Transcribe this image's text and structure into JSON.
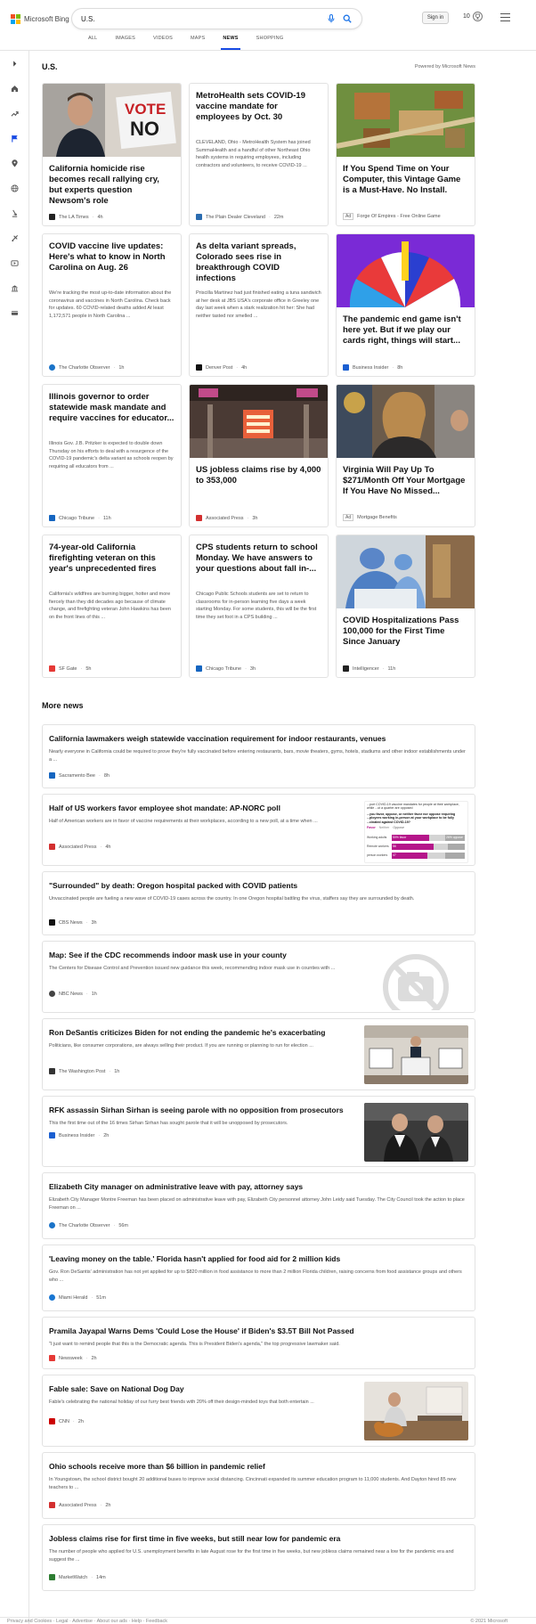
{
  "header": {
    "brand": "Microsoft Bing",
    "search_value": "U.S.",
    "signin_label": "Sign in",
    "rewards_count": "10",
    "tabs": [
      {
        "label": "ALL"
      },
      {
        "label": "IMAGES"
      },
      {
        "label": "VIDEOS"
      },
      {
        "label": "MAPS"
      },
      {
        "label": "NEWS"
      },
      {
        "label": "SHOPPING"
      }
    ],
    "active_tab": "NEWS",
    "brand_colors": [
      "#f25022",
      "#7fba00",
      "#00a4ef",
      "#ffb900"
    ],
    "accent": "#174ae4"
  },
  "rail": {
    "icons": [
      "chevron-right-icon",
      "home-icon",
      "trending-icon",
      "flag-icon",
      "location-pin-icon",
      "globe-icon",
      "science-icon",
      "sports-icon",
      "entertainment-icon",
      "business-icon",
      "money-icon"
    ]
  },
  "section": {
    "title": "U.S.",
    "powered_by": "Powered by Microsoft News"
  },
  "cards": [
    {
      "title": "California homicide rise becomes recall rallying cry, but experts question Newsom's role",
      "snippet": "",
      "source": "The LA Times",
      "time": "4h",
      "source_color": "#222",
      "has_image": true
    },
    {
      "title": "MetroHealth sets COVID-19 vaccine mandate for employees by Oct. 30",
      "snippet": "CLEVELAND, Ohio - MetroHealth System has joined SummaHealth and a handful of other Northeast Ohio health systems in requiring employees, including contractors and volunteers, to receive COVID-19 ...",
      "source": "The Plain Dealer Cleveland",
      "time": "22m",
      "source_color": "#2b6cb0",
      "has_image": false
    },
    {
      "title": "If You Spend Time on Your Computer, this Vintage Game is a Must-Have. No Install.",
      "snippet": "",
      "source": "Forge Of Empires - Free Online Game",
      "time": "",
      "ad_label": "Ad",
      "source_color": "",
      "has_image": true
    },
    {
      "title": "COVID vaccine live updates: Here's what to know in North Carolina on Aug. 26",
      "snippet": "We're tracking the most up-to-date information about the coronavirus and vaccines in North Carolina. Check back for updates. 60 COVID-related deaths added At least 1,172,571 people in North Carolina ...",
      "source": "The Charlotte Observer",
      "time": "1h",
      "source_color": "#1a73c8",
      "has_image": false
    },
    {
      "title": "As delta variant spreads, Colorado sees rise in breakthrough COVID infections",
      "snippet": "Priscilla Martinez had just finished eating a tuna sandwich at her desk at JBS USA's corporate office in Greeley one day last week when a stark realization hit her: She had neither tasted nor smelled ...",
      "source": "Denver Post",
      "time": "4h",
      "source_color": "#111",
      "has_image": false
    },
    {
      "title": "The pandemic end game isn't here yet. But if we play our cards right, things will start...",
      "snippet": "",
      "source": "Business Insider",
      "time": "8h",
      "source_color": "#1b5fd1",
      "has_image": true
    },
    {
      "title": "Illinois governor to order statewide mask mandate and require vaccines for educator...",
      "snippet": "Illinois Gov. J.B. Pritzker is expected to double down Thursday on his efforts to deal with a resurgence of the COVID-19 pandemic's delta variant as schools reopen by requiring all educators from ...",
      "source": "Chicago Tribune",
      "time": "11h",
      "source_color": "#1565c0",
      "has_image": false
    },
    {
      "title": "US jobless claims rise by 4,000 to 353,000",
      "snippet": "",
      "source": "Associated Press",
      "time": "3h",
      "source_color": "#d32f2f",
      "has_image": true
    },
    {
      "title": "Virginia Will Pay Up To $271/Month Off Your Mortgage If You Have No Missed...",
      "snippet": "",
      "source": "Mortgage Benefits",
      "time": "",
      "ad_label": "Ad",
      "source_color": "",
      "has_image": true
    },
    {
      "title": "74-year-old California firefighting veteran on this year's unprecedented fires",
      "snippet": "California's wildfires are burning bigger, hotter and more fiercely than they did decades ago because of climate change, and firefighting veteran John Hawkins has been on the front lines of this ...",
      "source": "SF Gate",
      "time": "5h",
      "source_color": "#e53935",
      "has_image": false
    },
    {
      "title": "CPS students return to school Monday. We have answers to your questions about fall in-...",
      "snippet": "Chicago Public Schools students are set to return to classrooms for in-person learning five days a week starting Monday. For some students, this will be the first time they set foot in a CPS building ...",
      "source": "Chicago Tribune",
      "time": "3h",
      "source_color": "#1565c0",
      "has_image": false
    },
    {
      "title": "COVID Hospitalizations Pass 100,000 for the First Time Since January",
      "snippet": "",
      "source": "Intelligencer",
      "time": "11h",
      "source_color": "#222",
      "has_image": true
    }
  ],
  "more_news": {
    "title": "More news",
    "items": [
      {
        "title": "California lawmakers weigh statewide vaccination requirement for indoor restaurants, venues",
        "snippet": "Nearly everyone in California could be required to prove they're fully vaccinated before entering restaurants, bars, movie theaters, gyms, hotels, stadiums and other indoor establishments under a ...",
        "source": "Sacramento Bee",
        "time": "8h",
        "source_color": "#1565c0"
      },
      {
        "title": "Half of US workers favor employee shot mandate: AP-NORC poll",
        "snippet": "Half of American workers are in favor of vaccine requirements at their workplaces, according to a new poll, at a time when ...",
        "source": "Associated Press",
        "time": "4h",
        "source_color": "#d32f2f",
        "thumb": {
          "heading": "...port COVID-19 vaccine mandates for people at their workplace, while ...ut a quarter are opposed",
          "question": "...you favor, oppose, or neither favor nor oppose requiring ...ployees working in-person at your workplace to be fully ...cinated against COVID-19?",
          "legend": [
            "Favor",
            "Neither",
            "Oppose"
          ],
          "rows": [
            {
              "label": "Working adults",
              "favor_text": "50% favor",
              "oppose_text": "26% oppose"
            },
            {
              "label": "Remote workers",
              "favor_text": "56",
              "oppose_text": ""
            },
            {
              "label": "person workers",
              "favor_text": "47",
              "oppose_text": ""
            }
          ]
        }
      },
      {
        "title": "\"Surrounded\" by death: Oregon hospital packed with COVID patients",
        "snippet": "Unvaccinated people are fueling a new wave of COVID-19 cases across the country. In one Oregon hospital battling the virus, staffers say they are surrounded by death.",
        "source": "CBS News",
        "time": "3h",
        "source_color": "#111"
      },
      {
        "title": "Map: See if the CDC recommends indoor mask use in your county",
        "snippet": "The Centers for Disease Control and Prevention issued new guidance this week, recommending indoor mask use in counties with ...",
        "source": "NBC News",
        "time": "1h",
        "source_color": "#444"
      },
      {
        "title": "Ron DeSantis criticizes Biden for not ending the pandemic he's exacerbating",
        "snippet": "Politicians, like consumer corporations, are always selling their product. If you are running or planning to run for election ...",
        "source": "The Washington Post",
        "time": "1h",
        "source_color": "#333"
      },
      {
        "title": "RFK assassin Sirhan Sirhan is seeing parole with no opposition from prosecutors",
        "snippet": "This the first time out of the 16 times Sirhan Sirhan has sought parole that it will be unopposed by prosecutors.",
        "source": "Business Insider",
        "time": "2h",
        "source_color": "#1b5fd1"
      },
      {
        "title": "Elizabeth City manager on administrative leave with pay, attorney says",
        "snippet": "Elizabeth City Manager Montre Freeman has been placed on administrative leave with pay, Elizabeth City personnel attorney John Leidy said Tuesday. The City Council took the action to place Freeman on ...",
        "source": "The Charlotte Observer",
        "time": "56m",
        "source_color": "#1a73c8"
      },
      {
        "title": "'Leaving money on the table.' Florida hasn't applied for food aid for 2 million kids",
        "snippet": "Gov. Ron DeSantis' administration has not yet applied for up to $820 million in food assistance to more than 2 million Florida children, raising concerns from food assistance groups and others who ...",
        "source": "Miami Herald",
        "time": "51m",
        "source_color": "#1976d2"
      },
      {
        "title": "Pramila Jayapal Warns Dems 'Could Lose the House' if Biden's $3.5T Bill Not Passed",
        "snippet": "\"I just want to remind people that this is the Democratic agenda. This is President Biden's agenda,\" the top progressive lawmaker said.",
        "source": "Newsweek",
        "time": "2h",
        "source_color": "#e53935"
      },
      {
        "title": "Fable sale: Save on National Dog Day",
        "snippet": "Fable's celebrating the national holiday of our furry best friends with 20% off their design-minded toys that both entertain ...",
        "source": "CNN",
        "time": "2h",
        "source_color": "#cc0000"
      },
      {
        "title": "Ohio schools receive more than $6 billion in pandemic relief",
        "snippet": "In Youngstown, the school district bought 20 additional buses to improve social distancing. Cincinnati expanded its summer education program to 11,000 students. And Dayton hired 85 new teachers to ...",
        "source": "Associated Press",
        "time": "2h",
        "source_color": "#d32f2f"
      },
      {
        "title": "Jobless claims rise for first time in five weeks, but still near low for pandemic era",
        "snippet": "The number of people who applied for U.S. unemployment benefits in late August rose for the first time in five weeks, but new jobless claims remained near a low for the pandemic era and suggest the ...",
        "source": "MarketWatch",
        "time": "14m",
        "source_color": "#2e7d32"
      }
    ]
  },
  "footer": {
    "left": "Privacy and Cookies · Legal · Advertise · About our ads · Help · Feedback",
    "right": "© 2021 Microsoft"
  }
}
